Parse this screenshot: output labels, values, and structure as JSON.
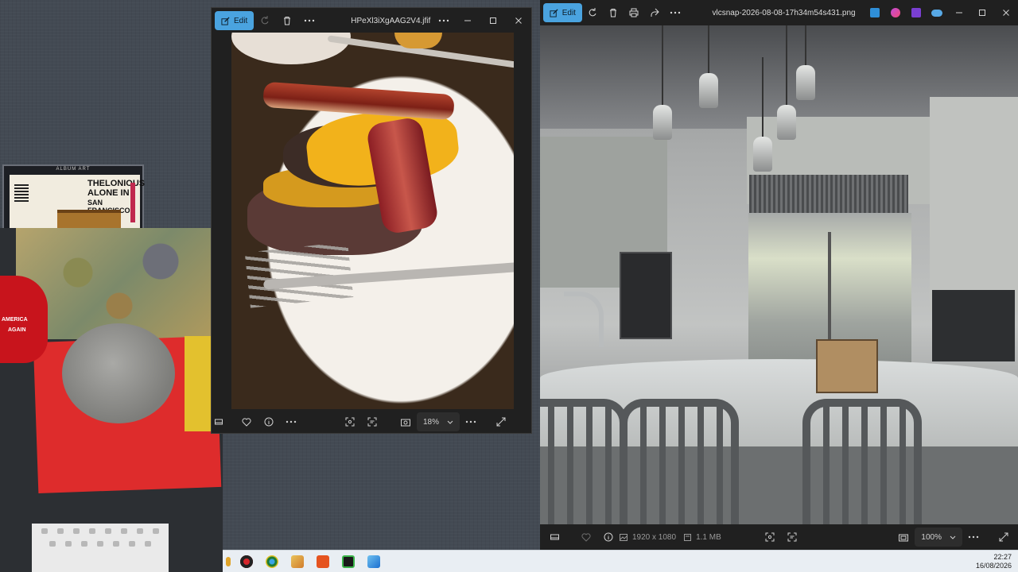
{
  "album_widget": {
    "title": "ALBUM ART",
    "cover_line1": "THELONIOUS",
    "cover_line2": "ALONE IN",
    "cover_line3": "SAN FRANCISCO"
  },
  "webcam": {
    "hat_line1": "AMERICA",
    "hat_line2": "AGAIN"
  },
  "photo_window_1": {
    "edit_label": "Edit",
    "filename": "HPeXl3iXgAAG2V4.jfif",
    "zoom_value": "18%",
    "icons": {
      "edit": "edit-icon",
      "rotate": "rotate-icon",
      "delete": "delete-icon",
      "more": "more-icon",
      "minimize": "minimize-icon",
      "maximize": "maximize-icon",
      "close": "close-icon",
      "filmstrip": "filmstrip-icon",
      "favorite": "heart-icon",
      "info": "info-icon",
      "ocr": "scan-text-icon",
      "visual_search": "visual-search-icon",
      "fit": "fit-icon",
      "fullscreen": "fullscreen-icon"
    }
  },
  "photo_window_2": {
    "edit_label": "Edit",
    "filename": "vlcsnap-2026-08-08-17h34m54s431.png",
    "resolution": "1920 x 1080",
    "file_size": "1.1 MB",
    "zoom_value": "100%",
    "icons": {
      "edit": "edit-icon",
      "rotate": "rotate-icon",
      "delete": "delete-icon",
      "print": "print-icon",
      "share": "share-icon",
      "more": "more-icon",
      "minimize": "minimize-icon",
      "maximize": "maximize-icon",
      "close": "close-icon"
    }
  },
  "taskbar": {
    "time": "22:27",
    "date": "16/08/2026"
  },
  "colors": {
    "accent": "#4aa3df",
    "window_bg": "#202020",
    "desktop": "#434a53"
  }
}
